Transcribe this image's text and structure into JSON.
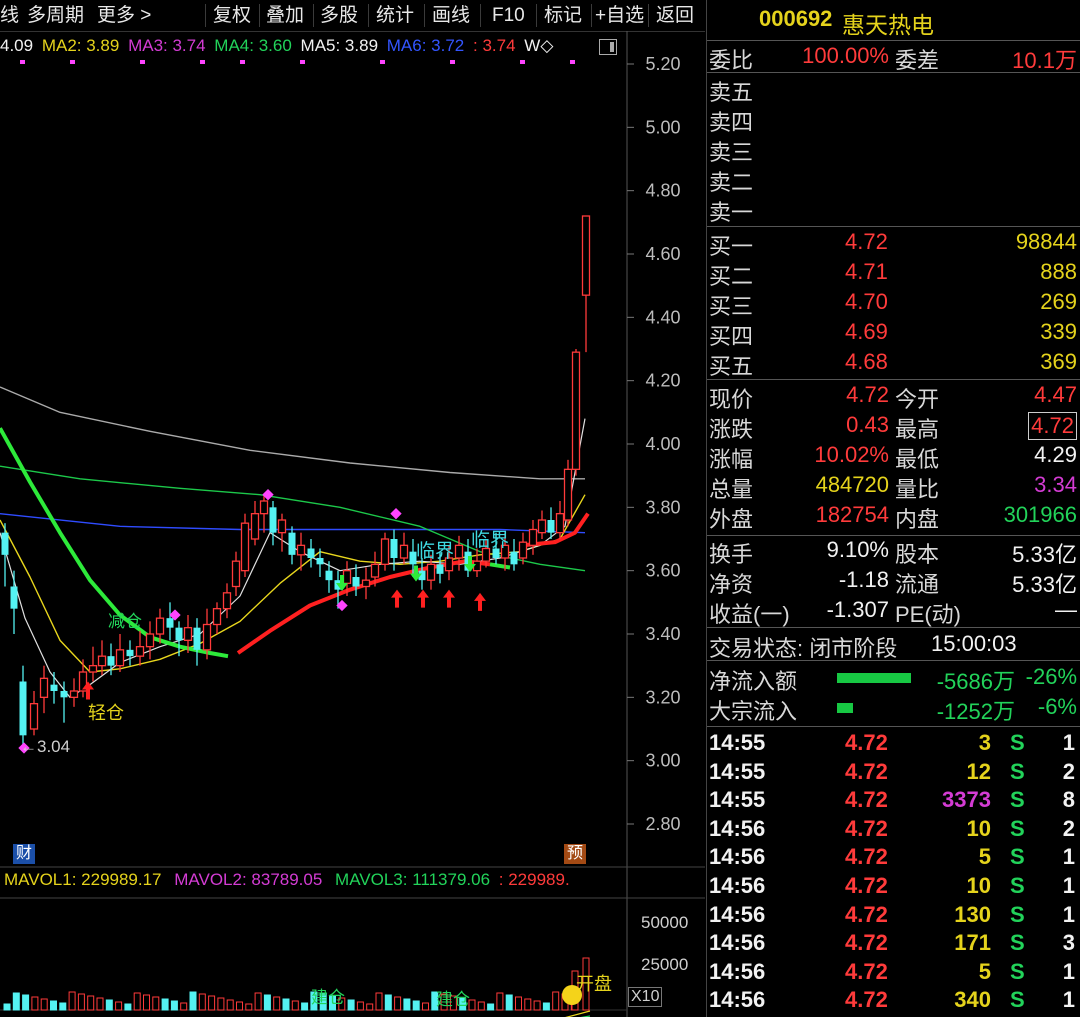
{
  "toolbar": {
    "items": [
      "线",
      "多周期",
      "更多 >",
      "复权",
      "叠加",
      "多股",
      "统计",
      "画线",
      "F10",
      "标记",
      "+自选",
      "返回"
    ]
  },
  "ma_legend": {
    "ma1": "4.09",
    "ma2": "MA2: 3.89",
    "ma3": "MA3: 3.74",
    "ma4": "MA4: 3.60",
    "ma5": "MA5: 3.89",
    "ma6": "MA6: 3.72",
    "ma7": ": 3.74",
    "w": "W◇"
  },
  "chart_data": {
    "type": "candlestick",
    "y_ticks": [
      "5.20",
      "5.00",
      "4.80",
      "4.60",
      "4.40",
      "4.20",
      "4.00",
      "3.80",
      "3.60",
      "3.40",
      "3.20",
      "3.00",
      "2.80"
    ],
    "ylim": [
      2.8,
      5.2
    ],
    "annotations": {
      "low_marker": "←3.04",
      "jiancang": "减仓",
      "qingcang": "轻仓",
      "linjie1": "临界",
      "linjie2": "临界",
      "cai": "财",
      "yu": "预"
    },
    "volume": {
      "mavol1": "MAVOL1: 229989.17",
      "mavol2": "MAVOL2: 83789.05",
      "mavol3": "MAVOL3: 111379.06",
      "mavol4": ": 229989.",
      "ticks": [
        "50000",
        "25000"
      ],
      "x10": "X10",
      "labels": [
        "建仓",
        "建仓",
        "开盘"
      ]
    }
  },
  "quote": {
    "code": "000692",
    "name": "惠天热电",
    "weibi_label": "委比",
    "weibi": "100.00%",
    "weicha_label": "委差",
    "weicha": "10.1万",
    "sells": [
      "卖五",
      "卖四",
      "卖三",
      "卖二",
      "卖一"
    ],
    "buys": [
      {
        "label": "买一",
        "price": "4.72",
        "vol": "98844"
      },
      {
        "label": "买二",
        "price": "4.71",
        "vol": "888"
      },
      {
        "label": "买三",
        "price": "4.70",
        "vol": "269"
      },
      {
        "label": "买四",
        "price": "4.69",
        "vol": "339"
      },
      {
        "label": "买五",
        "price": "4.68",
        "vol": "369"
      }
    ],
    "stats": [
      {
        "l1": "现价",
        "v1": "4.72",
        "l2": "今开",
        "v2": "4.47"
      },
      {
        "l1": "涨跌",
        "v1": "0.43",
        "l2": "最高",
        "v2": "4.72"
      },
      {
        "l1": "涨幅",
        "v1": "10.02%",
        "l2": "最低",
        "v2": "4.29"
      },
      {
        "l1": "总量",
        "v1": "484720",
        "l2": "量比",
        "v2": "3.34"
      },
      {
        "l1": "外盘",
        "v1": "182754",
        "l2": "内盘",
        "v2": "301966"
      }
    ],
    "fund": [
      {
        "l1": "换手",
        "v1": "9.10%",
        "l2": "股本",
        "v2": "5.33亿"
      },
      {
        "l1": "净资",
        "v1": "-1.18",
        "l2": "流通",
        "v2": "5.33亿"
      },
      {
        "l1": "收益(一)",
        "v1": "-1.307",
        "l2": "PE(动)",
        "v2": "—"
      }
    ],
    "status_label": "交易状态: 闭市阶段",
    "status_time": "15:00:03",
    "flow": [
      {
        "label": "净流入额",
        "value": "-5686万",
        "pct": "-26%"
      },
      {
        "label": "大宗流入",
        "value": "-1252万",
        "pct": "-6%"
      }
    ],
    "ticks": [
      {
        "t": "14:55",
        "p": "4.72",
        "v": "3",
        "s": "S",
        "n": "1"
      },
      {
        "t": "14:55",
        "p": "4.72",
        "v": "12",
        "s": "S",
        "n": "2"
      },
      {
        "t": "14:55",
        "p": "4.72",
        "v": "3373",
        "s": "S",
        "n": "8"
      },
      {
        "t": "14:56",
        "p": "4.72",
        "v": "10",
        "s": "S",
        "n": "2"
      },
      {
        "t": "14:56",
        "p": "4.72",
        "v": "5",
        "s": "S",
        "n": "1"
      },
      {
        "t": "14:56",
        "p": "4.72",
        "v": "10",
        "s": "S",
        "n": "1"
      },
      {
        "t": "14:56",
        "p": "4.72",
        "v": "130",
        "s": "S",
        "n": "1"
      },
      {
        "t": "14:56",
        "p": "4.72",
        "v": "171",
        "s": "S",
        "n": "3"
      },
      {
        "t": "14:56",
        "p": "4.72",
        "v": "5",
        "s": "S",
        "n": "1"
      },
      {
        "t": "14:56",
        "p": "4.72",
        "v": "340",
        "s": "S",
        "n": "1"
      }
    ]
  }
}
